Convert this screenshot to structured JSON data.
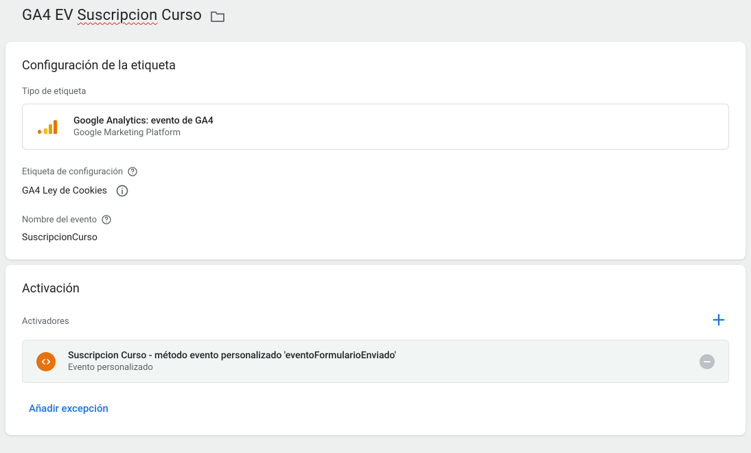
{
  "header": {
    "title_prefix": "GA4 EV ",
    "title_underlined": "Suscripcion",
    "title_suffix": " Curso"
  },
  "tag_config": {
    "section_title": "Configuración de la etiqueta",
    "type_label": "Tipo de etiqueta",
    "type_name": "Google Analytics: evento de GA4",
    "type_vendor": "Google Marketing Platform",
    "config_tag_label": "Etiqueta de configuración",
    "config_tag_value": "GA4 Ley de Cookies",
    "event_name_label": "Nombre del evento",
    "event_name_value": "SuscripcionCurso"
  },
  "triggering": {
    "section_title": "Activación",
    "triggers_label": "Activadores",
    "trigger_name": "Suscripcion Curso - método evento personalizado 'eventoFormularioEnviado'",
    "trigger_type": "Evento personalizado",
    "add_exception_label": "Añadir excepción"
  },
  "icons": {
    "folder": "folder-icon",
    "help": "help-icon",
    "info": "info-icon",
    "plus": "plus-icon",
    "minus": "minus-icon",
    "code": "code-icon",
    "ga4": "ga4-icon"
  },
  "colors": {
    "accent_blue": "#1a73e8",
    "gray_text": "#5f6368",
    "orange": "#e8710a"
  }
}
